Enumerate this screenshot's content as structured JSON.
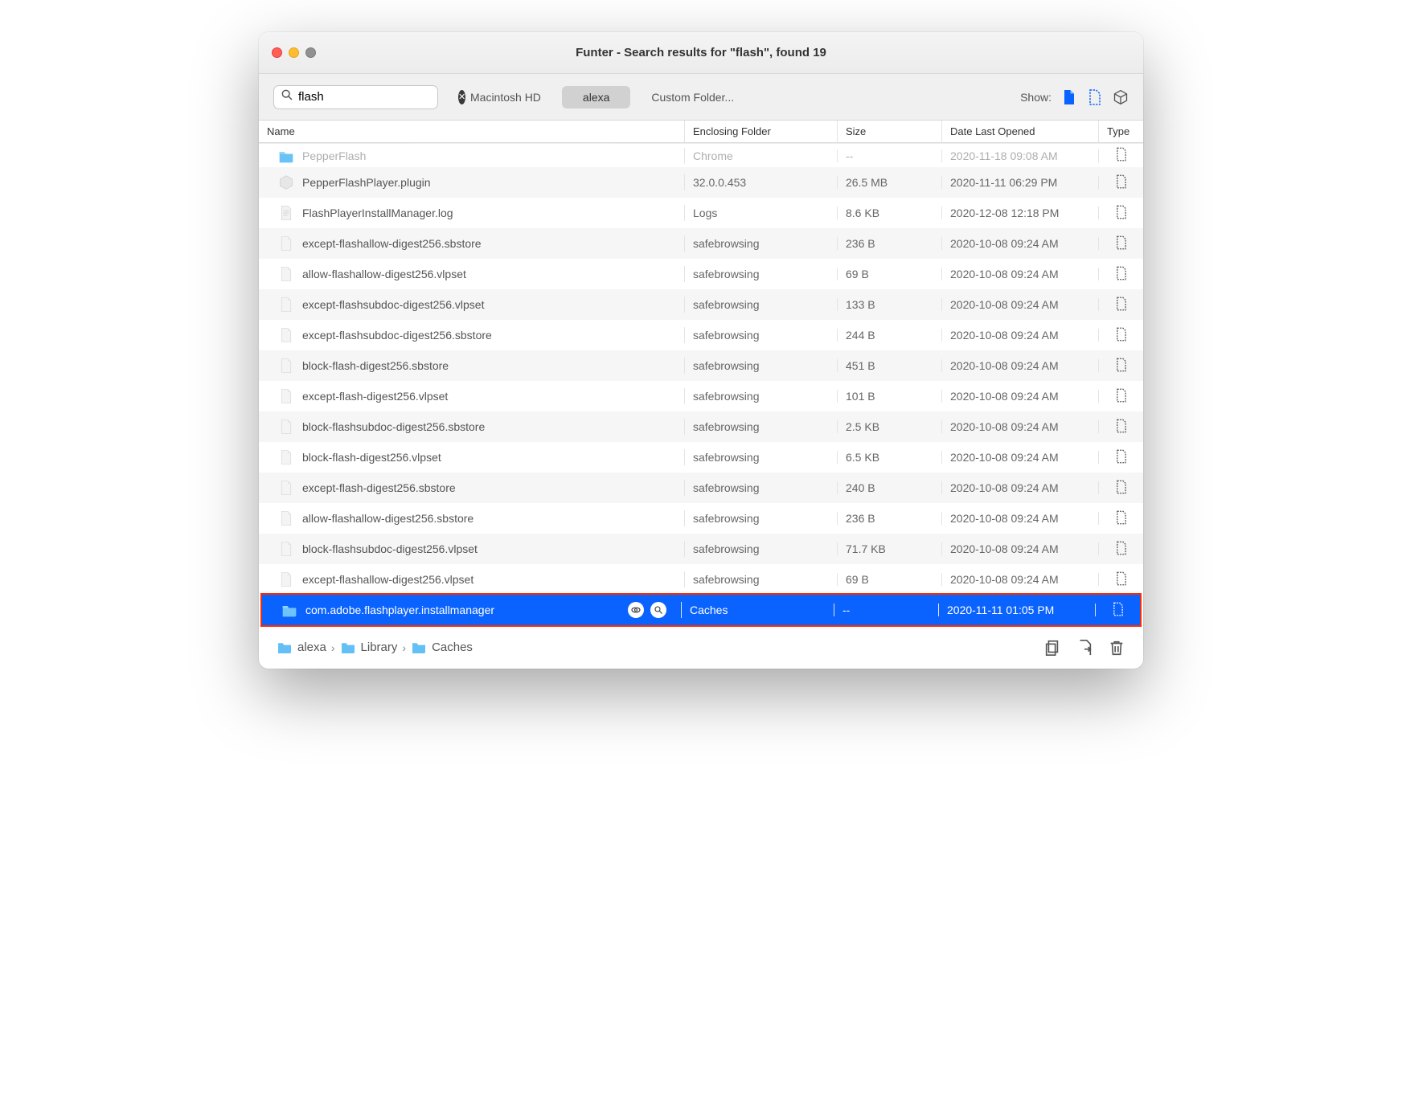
{
  "window": {
    "title": "Funter - Search results for \"flash\", found 19"
  },
  "search": {
    "value": "flash",
    "placeholder": "Search"
  },
  "locations": {
    "items": [
      "Macintosh HD",
      "alexa",
      "Custom Folder..."
    ],
    "activeIndex": 1
  },
  "show_label": "Show:",
  "columns": {
    "name": "Name",
    "folder": "Enclosing Folder",
    "size": "Size",
    "date": "Date Last Opened",
    "type": "Type"
  },
  "rows": [
    {
      "icon": "folder",
      "name": "PepperFlash",
      "folder": "Chrome",
      "size": "--",
      "date": "2020-11-18 09:08 AM",
      "type": "hidden",
      "clipped": true
    },
    {
      "icon": "plugin",
      "name": "PepperFlashPlayer.plugin",
      "folder": "32.0.0.453",
      "size": "26.5 MB",
      "date": "2020-11-11 06:29 PM",
      "type": "hidden"
    },
    {
      "icon": "log",
      "name": "FlashPlayerInstallManager.log",
      "folder": "Logs",
      "size": "8.6 KB",
      "date": "2020-12-08 12:18 PM",
      "type": "hidden"
    },
    {
      "icon": "doc",
      "name": "except-flashallow-digest256.sbstore",
      "folder": "safebrowsing",
      "size": "236 B",
      "date": "2020-10-08 09:24 AM",
      "type": "hidden"
    },
    {
      "icon": "doc",
      "name": "allow-flashallow-digest256.vlpset",
      "folder": "safebrowsing",
      "size": "69 B",
      "date": "2020-10-08 09:24 AM",
      "type": "hidden"
    },
    {
      "icon": "doc",
      "name": "except-flashsubdoc-digest256.vlpset",
      "folder": "safebrowsing",
      "size": "133 B",
      "date": "2020-10-08 09:24 AM",
      "type": "hidden"
    },
    {
      "icon": "doc",
      "name": "except-flashsubdoc-digest256.sbstore",
      "folder": "safebrowsing",
      "size": "244 B",
      "date": "2020-10-08 09:24 AM",
      "type": "hidden"
    },
    {
      "icon": "doc",
      "name": "block-flash-digest256.sbstore",
      "folder": "safebrowsing",
      "size": "451 B",
      "date": "2020-10-08 09:24 AM",
      "type": "hidden"
    },
    {
      "icon": "doc",
      "name": "except-flash-digest256.vlpset",
      "folder": "safebrowsing",
      "size": "101 B",
      "date": "2020-10-08 09:24 AM",
      "type": "hidden"
    },
    {
      "icon": "doc",
      "name": "block-flashsubdoc-digest256.sbstore",
      "folder": "safebrowsing",
      "size": "2.5 KB",
      "date": "2020-10-08 09:24 AM",
      "type": "hidden"
    },
    {
      "icon": "doc",
      "name": "block-flash-digest256.vlpset",
      "folder": "safebrowsing",
      "size": "6.5 KB",
      "date": "2020-10-08 09:24 AM",
      "type": "hidden"
    },
    {
      "icon": "doc",
      "name": "except-flash-digest256.sbstore",
      "folder": "safebrowsing",
      "size": "240 B",
      "date": "2020-10-08 09:24 AM",
      "type": "hidden"
    },
    {
      "icon": "doc",
      "name": "allow-flashallow-digest256.sbstore",
      "folder": "safebrowsing",
      "size": "236 B",
      "date": "2020-10-08 09:24 AM",
      "type": "hidden"
    },
    {
      "icon": "doc",
      "name": "block-flashsubdoc-digest256.vlpset",
      "folder": "safebrowsing",
      "size": "71.7 KB",
      "date": "2020-10-08 09:24 AM",
      "type": "hidden"
    },
    {
      "icon": "doc",
      "name": "except-flashallow-digest256.vlpset",
      "folder": "safebrowsing",
      "size": "69 B",
      "date": "2020-10-08 09:24 AM",
      "type": "hidden"
    },
    {
      "icon": "folder",
      "name": "com.adobe.flashplayer.installmanager",
      "folder": "Caches",
      "size": "--",
      "date": "2020-11-11 01:05 PM",
      "type": "hidden",
      "selected": true,
      "highlighted": true
    }
  ],
  "breadcrumbs": [
    "alexa",
    "Library",
    "Caches"
  ]
}
